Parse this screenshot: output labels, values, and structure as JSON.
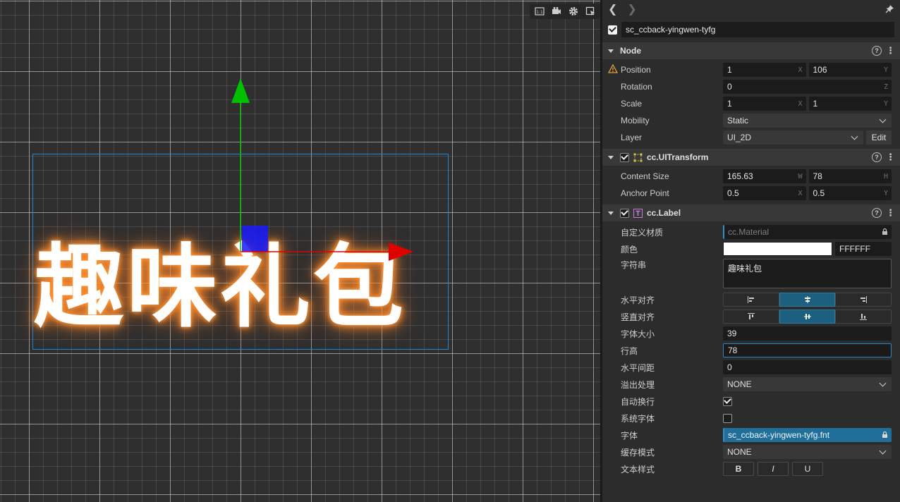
{
  "scene": {
    "label_text": "趣味礼包",
    "toolbar": [
      "grid-icon",
      "camera-icon",
      "settings-icon",
      "snap-icon"
    ]
  },
  "inspector": {
    "node_name": "sc_ccback-yingwen-tyfg",
    "node_section": {
      "title": "Node",
      "position": {
        "label": "Position",
        "x": "1",
        "y": "106",
        "x_axis": "X",
        "y_axis": "Y"
      },
      "rotation": {
        "label": "Rotation",
        "z": "0",
        "z_axis": "Z"
      },
      "scale": {
        "label": "Scale",
        "x": "1",
        "y": "1",
        "x_axis": "X",
        "y_axis": "Y"
      },
      "mobility": {
        "label": "Mobility",
        "value": "Static"
      },
      "layer": {
        "label": "Layer",
        "value": "UI_2D",
        "edit": "Edit"
      }
    },
    "uitransform": {
      "title": "cc.UITransform",
      "content_size": {
        "label": "Content Size",
        "w": "165.63",
        "h": "78",
        "w_axis": "W",
        "h_axis": "H"
      },
      "anchor_point": {
        "label": "Anchor Point",
        "x": "0.5",
        "y": "0.5",
        "x_axis": "X",
        "y_axis": "Y"
      }
    },
    "label": {
      "title": "cc.Label",
      "custom_material": {
        "label": "自定义材质",
        "value": "cc.Material"
      },
      "color": {
        "label": "颜色",
        "hex": "FFFFFF",
        "swatch": "#ffffff"
      },
      "string": {
        "label": "字符串",
        "value": "趣味礼包"
      },
      "h_align": {
        "label": "水平对齐",
        "selected": "center"
      },
      "v_align": {
        "label": "竖直对齐",
        "selected": "center"
      },
      "font_size": {
        "label": "字体大小",
        "value": "39"
      },
      "line_height": {
        "label": "行高",
        "value": "78"
      },
      "spacing_x": {
        "label": "水平间距",
        "value": "0"
      },
      "overflow": {
        "label": "溢出处理",
        "value": "NONE"
      },
      "wrap": {
        "label": "自动换行",
        "checked": true
      },
      "system_font": {
        "label": "系统字体",
        "checked": false
      },
      "font": {
        "label": "字体",
        "value": "sc_ccback-yingwen-tyfg.fnt"
      },
      "cache_mode": {
        "label": "缓存模式",
        "value": "NONE"
      },
      "text_style": {
        "label": "文本样式",
        "bold": "B",
        "italic": "I",
        "underline": "U"
      }
    }
  },
  "colors": {
    "accent": "#1e88d6",
    "glow": "#ff8a2a",
    "axis_x": "#e00000",
    "axis_y": "#00c000"
  }
}
